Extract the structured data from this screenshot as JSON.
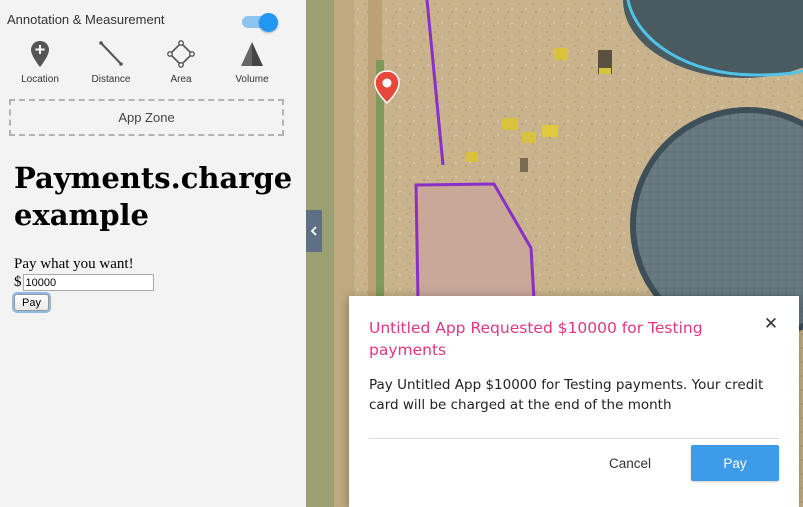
{
  "sidebar": {
    "header": "Annotation & Measurement",
    "toggle_on": true,
    "tools": [
      {
        "label": "Location",
        "icon": "location-pin-icon"
      },
      {
        "label": "Distance",
        "icon": "distance-line-icon"
      },
      {
        "label": "Area",
        "icon": "area-polygon-icon"
      },
      {
        "label": "Volume",
        "icon": "volume-pyramid-icon"
      }
    ],
    "app_zone": "App Zone"
  },
  "app": {
    "title": "Payments.charge example",
    "prompt": "Pay what you want!",
    "currency": "$",
    "amount": "10000",
    "pay_button": "Pay"
  },
  "map": {
    "collapse_icon": "chevron-left-icon",
    "marker_icon": "map-marker-icon",
    "colors": {
      "annotation": "#8b2fc9",
      "tank_outline": "#4fc3e8",
      "marker": "#e8473c"
    }
  },
  "dialog": {
    "title": "Untitled App Requested $10000 for Testing payments",
    "body": "Pay Untitled App $10000 for Testing payments. Your credit card will be charged at the end of the month",
    "cancel_label": "Cancel",
    "pay_label": "Pay",
    "close_icon": "close-icon",
    "colors": {
      "title": "#e0377f",
      "pay_button": "#3d9be9"
    }
  }
}
